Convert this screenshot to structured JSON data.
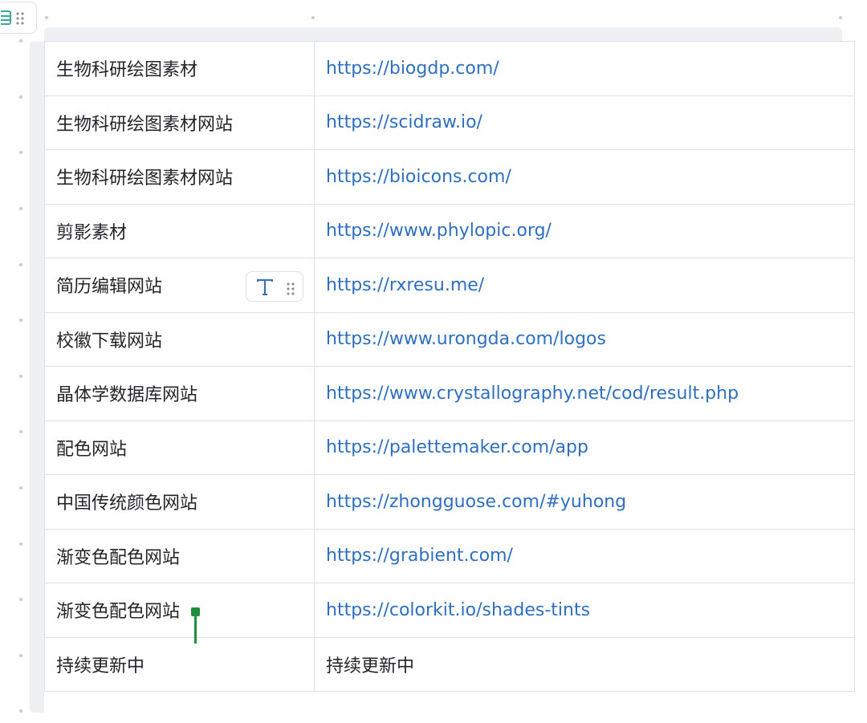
{
  "accent_colors": {
    "link": "#2f6fbf",
    "cursor": "#1f8f3d",
    "border": "#dcdfe4"
  },
  "icons": {
    "table_handle": [
      "table-icon",
      "drag-grip-icon"
    ],
    "cell_toolbar": [
      "text-type-icon",
      "drag-grip-icon"
    ]
  },
  "table": {
    "rows": [
      {
        "name": "生物科研绘图素材",
        "url": "https://biogdp.com/"
      },
      {
        "name": "生物科研绘图素材网站",
        "url": "https://scidraw.io/"
      },
      {
        "name": "生物科研绘图素材网站",
        "url": "https://bioicons.com/"
      },
      {
        "name": "剪影素材",
        "url": "https://www.phylopic.org/"
      },
      {
        "name": "简历编辑网站",
        "url": "https://rxresu.me/"
      },
      {
        "name": "校徽下载网站",
        "url": "https://www.urongda.com/logos"
      },
      {
        "name": "晶体学数据库网站",
        "url": "https://www.crystallography.net/cod/result.php"
      },
      {
        "name": "配色网站",
        "url": "https://palettemaker.com/app"
      },
      {
        "name": "中国传统颜色网站",
        "url": "https://zhongguose.com/#yuhong"
      },
      {
        "name": "渐变色配色网站",
        "url": "https://grabient.com/"
      },
      {
        "name": "渐变色配色网站",
        "url": "https://colorkit.io/shades-tints"
      },
      {
        "name": "持续更新中",
        "url": "持续更新中"
      }
    ]
  }
}
